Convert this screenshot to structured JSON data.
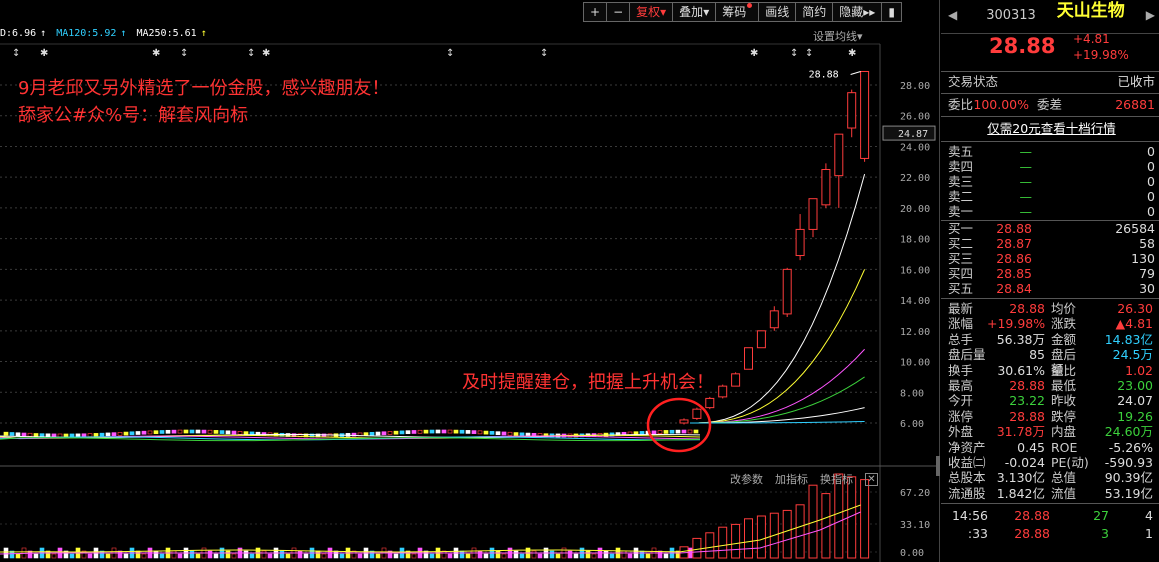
{
  "toolbar": {
    "plus": "+",
    "minus": "−",
    "fuquan": "复权",
    "diejia": "叠加",
    "choumai": "筹码",
    "huaxian": "画线",
    "jianyue": "简约",
    "yincang": "隐藏",
    "arrows": "▸▸",
    "extra": "▮"
  },
  "ma_legend": [
    {
      "text": "D:6.96",
      "color": "#ffffff"
    },
    {
      "text": "MA120:5.92",
      "color": "#30d0ff"
    },
    {
      "text": "MA250:5.61",
      "color": "#ffffff"
    }
  ],
  "chart_setting": "设置均线",
  "annotations": {
    "line1": "9月老邱又另外精选了一份金股，感兴趣朋友！",
    "line2": "舔家公#众%号：解套风向标",
    "line3": "及时提醒建仓，把握上升机会！"
  },
  "price_labels": [
    "28.00",
    "26.00",
    "24.00",
    "22.00",
    "20.00",
    "18.00",
    "16.00",
    "14.00",
    "12.00",
    "10.00",
    "8.00",
    "6.00"
  ],
  "current_price_tag": "24.87",
  "high_label": "28.88",
  "volume_labels": [
    "67.20",
    "33.10",
    "0.00"
  ],
  "indicator_bar": {
    "gaicanshu": "改参数",
    "jiazhibiao": "加指标",
    "huanzhibiao": "换指标",
    "close": "✕"
  },
  "stock": {
    "code": "300313",
    "name": "天山生物",
    "price": "28.88",
    "change": "+4.81",
    "change_pct": "+19.98%"
  },
  "trade_status": {
    "label": "交易状态",
    "value": "已收市"
  },
  "weibi": {
    "label": "委比",
    "value": "100.00%",
    "label2": "委差",
    "value2": "26881"
  },
  "level10_link": "仅需20元查看十档行情",
  "sell_orders": [
    {
      "name": "卖五",
      "price": "—",
      "vol": "0"
    },
    {
      "name": "卖四",
      "price": "—",
      "vol": "0"
    },
    {
      "name": "卖三",
      "price": "—",
      "vol": "0"
    },
    {
      "name": "卖二",
      "price": "—",
      "vol": "0"
    },
    {
      "name": "卖一",
      "price": "—",
      "vol": "0"
    }
  ],
  "buy_orders": [
    {
      "name": "买一",
      "price": "28.88",
      "vol": "26584"
    },
    {
      "name": "买二",
      "price": "28.87",
      "vol": "58"
    },
    {
      "name": "买三",
      "price": "28.86",
      "vol": "130"
    },
    {
      "name": "买四",
      "price": "28.85",
      "vol": "79"
    },
    {
      "name": "买五",
      "price": "28.84",
      "vol": "30"
    }
  ],
  "stats": [
    {
      "l1": "最新",
      "v1": "28.88",
      "c1": "red",
      "l2": "均价",
      "v2": "26.30",
      "c2": "red"
    },
    {
      "l1": "涨幅",
      "v1": "+19.98%",
      "c1": "red",
      "l2": "涨跌",
      "v2": "▲4.81",
      "c2": "red"
    },
    {
      "l1": "总手",
      "v1": "56.38万",
      "c1": "white",
      "l2": "金额",
      "v2": "14.83亿",
      "c2": "cyan"
    },
    {
      "l1": "盘后量",
      "v1": "85",
      "c1": "white",
      "l2": "盘后额",
      "v2": "24.5万",
      "c2": "cyan"
    },
    {
      "l1": "换手",
      "v1": "30.61%",
      "c1": "white",
      "l2": "量比",
      "v2": "1.02",
      "c2": "red"
    },
    {
      "l1": "最高",
      "v1": "28.88",
      "c1": "red",
      "l2": "最低",
      "v2": "23.00",
      "c2": "green"
    },
    {
      "l1": "今开",
      "v1": "23.22",
      "c1": "green",
      "l2": "昨收",
      "v2": "24.07",
      "c2": "white"
    },
    {
      "l1": "涨停",
      "v1": "28.88",
      "c1": "red",
      "l2": "跌停",
      "v2": "19.26",
      "c2": "green"
    },
    {
      "l1": "外盘",
      "v1": "31.78万",
      "c1": "red",
      "l2": "内盘",
      "v2": "24.60万",
      "c2": "green"
    },
    {
      "l1": "净资产",
      "v1": "0.45",
      "c1": "white",
      "l2": "ROE",
      "v2": "-5.26%",
      "c2": "white"
    },
    {
      "l1": "收益㈡",
      "v1": "-0.024",
      "c1": "white",
      "l2": "PE(动)",
      "v2": "-590.93",
      "c2": "white"
    },
    {
      "l1": "总股本",
      "v1": "3.130亿",
      "c1": "white",
      "l2": "总值",
      "v2": "90.39亿",
      "c2": "white"
    },
    {
      "l1": "流通股",
      "v1": "1.842亿",
      "c1": "white",
      "l2": "流值",
      "v2": "53.19亿",
      "c2": "white"
    }
  ],
  "ticks": [
    {
      "time": "14:56",
      "price": "28.88",
      "vol": "27",
      "n": "4"
    },
    {
      "time": ":33",
      "price": "28.88",
      "vol": "3",
      "n": "1"
    }
  ],
  "chart_data": {
    "type": "candlestick",
    "ylim": [
      4.0,
      29.5
    ],
    "yticks": [
      6,
      8,
      10,
      12,
      14,
      16,
      18,
      20,
      22,
      24,
      26,
      28
    ],
    "current_price": 24.87,
    "high": 28.88,
    "rally_candles": [
      {
        "o": 6.0,
        "c": 6.2,
        "h": 6.3,
        "l": 5.9
      },
      {
        "o": 6.3,
        "c": 6.9,
        "h": 7.0,
        "l": 6.2
      },
      {
        "o": 7.0,
        "c": 7.6,
        "h": 7.7,
        "l": 6.9
      },
      {
        "o": 7.7,
        "c": 8.4,
        "h": 8.5,
        "l": 7.6
      },
      {
        "o": 8.4,
        "c": 9.2,
        "h": 9.3,
        "l": 8.4
      },
      {
        "o": 9.5,
        "c": 10.9,
        "h": 10.9,
        "l": 9.5
      },
      {
        "o": 10.9,
        "c": 12.0,
        "h": 12.0,
        "l": 10.9
      },
      {
        "o": 12.2,
        "c": 13.3,
        "h": 13.6,
        "l": 12.0
      },
      {
        "o": 13.1,
        "c": 16.0,
        "h": 16.1,
        "l": 12.9
      },
      {
        "o": 16.9,
        "c": 18.6,
        "h": 19.6,
        "l": 16.6
      },
      {
        "o": 18.6,
        "c": 20.6,
        "h": 20.6,
        "l": 18.1
      },
      {
        "o": 20.2,
        "c": 22.5,
        "h": 22.9,
        "l": 20.0
      },
      {
        "o": 22.1,
        "c": 24.8,
        "h": 24.8,
        "l": 20.0
      },
      {
        "o": 25.2,
        "c": 27.5,
        "h": 27.7,
        "l": 24.6
      },
      {
        "o": 23.22,
        "c": 28.88,
        "h": 28.88,
        "l": 23.0
      }
    ],
    "volume_ylim": [
      0,
      67.2
    ],
    "volume_ticks": [
      67.2,
      33.1,
      0.0
    ]
  }
}
